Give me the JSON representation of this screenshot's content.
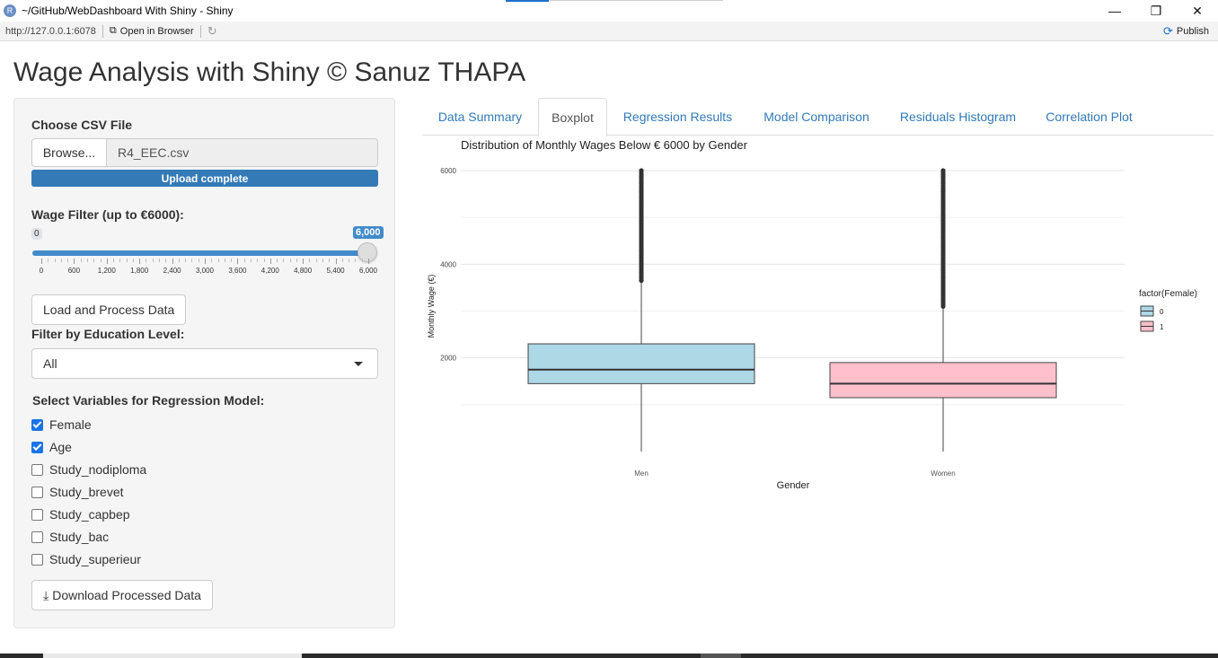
{
  "window": {
    "title": "~/GitHub/WebDashboard With Shiny - Shiny",
    "app_icon": "R",
    "controls": {
      "minimize": "—",
      "maximize": "❐",
      "close": "✕"
    }
  },
  "addressbar": {
    "url": "http://127.0.0.1:6078",
    "open_in_browser": "Open in Browser",
    "publish": "Publish"
  },
  "page": {
    "title": "Wage Analysis with Shiny © Sanuz THAPA"
  },
  "sidebar": {
    "file_input": {
      "label": "Choose CSV File",
      "browse": "Browse...",
      "filename": "R4_EEC.csv",
      "progress_text": "Upload complete",
      "progress": 1.0
    },
    "slider": {
      "label": "Wage Filter (up to €6000):",
      "min_label": "0",
      "value_label": "6,000",
      "min": 0,
      "max": 6000,
      "value": 6000,
      "ticks": [
        "0",
        "600",
        "1,200",
        "1,800",
        "2,400",
        "3,000",
        "3,600",
        "4,200",
        "4,800",
        "5,400",
        "6,000"
      ]
    },
    "load_button": "Load and Process Data",
    "education": {
      "label": "Filter by Education Level:",
      "selected": "All"
    },
    "variables": {
      "label": "Select Variables for Regression Model:",
      "items": [
        {
          "label": "Female",
          "checked": true
        },
        {
          "label": "Age",
          "checked": true
        },
        {
          "label": "Study_nodiploma",
          "checked": false
        },
        {
          "label": "Study_brevet",
          "checked": false
        },
        {
          "label": "Study_capbep",
          "checked": false
        },
        {
          "label": "Study_bac",
          "checked": false
        },
        {
          "label": "Study_superieur",
          "checked": false
        }
      ]
    },
    "download_button": "Download Processed Data"
  },
  "tabs": [
    {
      "label": "Data Summary",
      "active": false
    },
    {
      "label": "Boxplot",
      "active": true
    },
    {
      "label": "Regression Results",
      "active": false
    },
    {
      "label": "Model Comparison",
      "active": false
    },
    {
      "label": "Residuals Histogram",
      "active": false
    },
    {
      "label": "Correlation Plot",
      "active": false
    }
  ],
  "chart_data": {
    "type": "boxplot",
    "title": "Distribution of Monthly Wages Below € 6000  by Gender",
    "xlabel": "Gender",
    "ylabel": "Monthly Wage (€)",
    "ylim": [
      0,
      6200
    ],
    "yticks": [
      "2000",
      "4000",
      "6000"
    ],
    "categories": [
      "Men",
      "Women"
    ],
    "legend": {
      "title": "factor(Female)",
      "position": "right",
      "entries": [
        "0",
        "1"
      ]
    },
    "colors": {
      "0": "#add8e6",
      "1": "#ffc0cb"
    },
    "grid": true,
    "boxes": [
      {
        "category": "Men",
        "group": "0",
        "whisker_low": 0,
        "q1": 1450,
        "median": 1750,
        "q3": 2300,
        "whisker_high": 3650,
        "outliers_from": 3650,
        "outliers_to": 6000
      },
      {
        "category": "Women",
        "group": "1",
        "whisker_low": 0,
        "q1": 1150,
        "median": 1450,
        "q3": 1900,
        "whisker_high": 3100,
        "outliers_from": 3100,
        "outliers_to": 6000
      }
    ]
  }
}
